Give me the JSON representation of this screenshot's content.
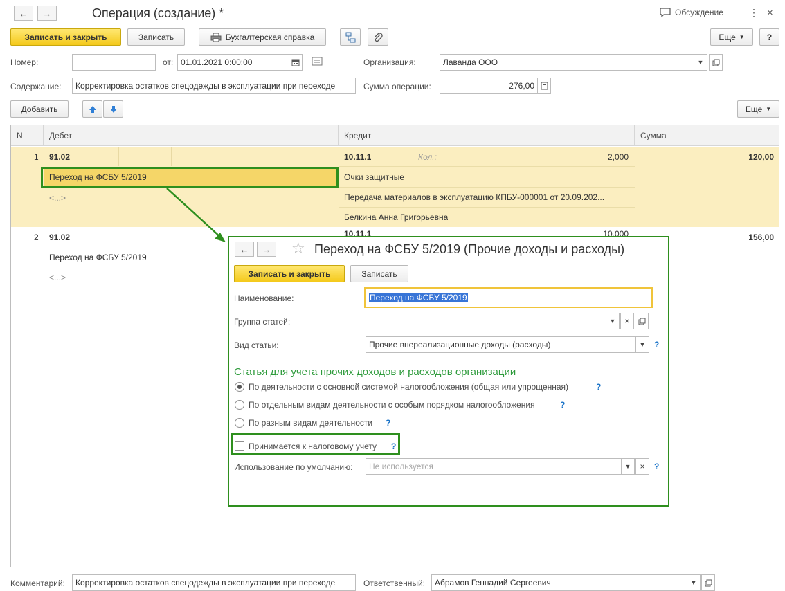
{
  "window": {
    "title": "Операция (создание) *",
    "discussion_label": "Обсуждение"
  },
  "toolbar": {
    "save_close_label": "Записать и закрыть",
    "save_label": "Записать",
    "report_label": "Бухгалтерская справка",
    "more_label": "Еще",
    "help_label": "?"
  },
  "form": {
    "number_label": "Номер:",
    "number_value": "",
    "date_label": "от:",
    "date_value": "01.01.2021  0:00:00",
    "org_label": "Организация:",
    "org_value": "Лаванда ООО",
    "content_label": "Содержание:",
    "content_value": "Корректировка остатков спецодежды в эксплуатации при переходе",
    "sum_label": "Сумма операции:",
    "sum_value": "276,00"
  },
  "table_toolbar": {
    "add_label": "Добавить",
    "more_label": "Еще"
  },
  "table": {
    "columns": [
      "N",
      "Дебет",
      "Кредит",
      "Сумма"
    ],
    "rows": [
      {
        "n": "1",
        "debit_account": "91.02",
        "debit_sub1": "Переход на ФСБУ 5/2019",
        "debit_sub2": "<...>",
        "credit_account": "10.11.1",
        "qty_label": "Кол.:",
        "qty_value": "2,000",
        "credit_sub1": "Очки защитные",
        "credit_sub2": "Передача материалов в эксплуатацию КПБУ-000001 от 20.09.202...",
        "credit_sub3": "Белкина Анна Григорьевна",
        "sum": "120,00"
      },
      {
        "n": "2",
        "debit_account": "91.02",
        "debit_sub1": "Переход на ФСБУ 5/2019",
        "debit_sub2": "<...>",
        "credit_account": "10.11.1",
        "qty_value": "10,000",
        "sum": "156,00"
      }
    ]
  },
  "popup": {
    "title": "Переход на ФСБУ 5/2019 (Прочие доходы и расходы)",
    "save_close_label": "Записать и закрыть",
    "save_label": "Записать",
    "name_label": "Наименование:",
    "name_value": "Переход на ФСБУ 5/2019",
    "group_label": "Группа статей:",
    "group_value": "",
    "kind_label": "Вид статьи:",
    "kind_value": "Прочие внереализационные доходы (расходы)",
    "section_title": "Статья для учета прочих доходов и расходов организации",
    "radio_options": [
      "По деятельности с основной системой налогообложения (общая или упрощенная)",
      "По отдельным видам деятельности с особым порядком налогообложения",
      "По разным видам деятельности"
    ],
    "radio_selected": 0,
    "tax_checkbox_label": "Принимается к налоговому учету",
    "tax_checkbox_checked": false,
    "default_use_label": "Использование по умолчанию:",
    "default_use_placeholder": "Не используется",
    "q_mark": "?"
  },
  "footer": {
    "comment_label": "Комментарий:",
    "comment_value": "Корректировка остатков спецодежды в эксплуатации при переходе",
    "responsible_label": "Ответственный:",
    "responsible_value": "Абрамов Геннадий Сергеевич"
  },
  "colors": {
    "accent_yellow": "#f4c91b",
    "highlight_row": "#fbeec0",
    "annotation_green": "#2e8f1e",
    "section_green": "#2e9b3c",
    "selection_blue": "#3875d7"
  }
}
